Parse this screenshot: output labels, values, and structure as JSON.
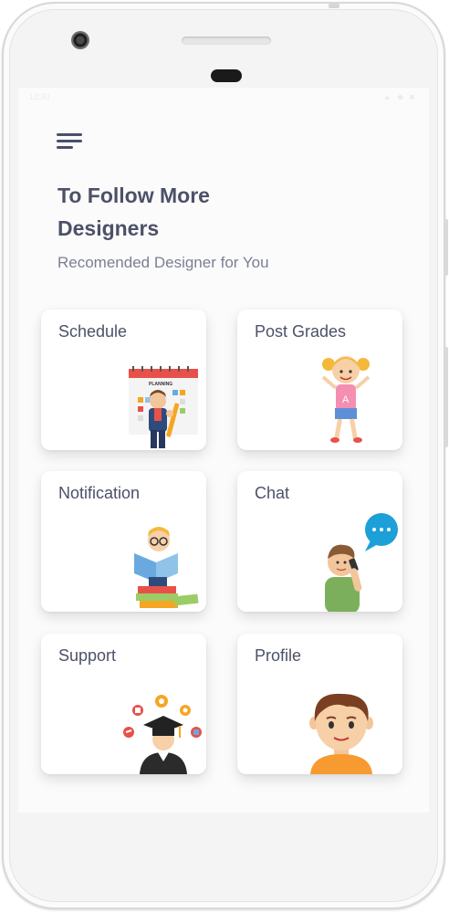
{
  "status": {
    "time": "12:30",
    "icons": "▲ ◆ ■"
  },
  "header": {
    "title": "To Follow More Designers",
    "subtitle": "Recomended Designer for You"
  },
  "cards": [
    {
      "label": "Schedule",
      "illustration": "planning-calendar-icon"
    },
    {
      "label": "Post Grades",
      "illustration": "happy-girl-icon"
    },
    {
      "label": "Notification",
      "illustration": "student-reading-books-icon"
    },
    {
      "label": "Chat",
      "illustration": "man-on-phone-chat-icon"
    },
    {
      "label": "Support",
      "illustration": "graduate-with-ideas-icon"
    },
    {
      "label": "Profile",
      "illustration": "boy-avatar-icon"
    }
  ],
  "calendar_label": "PLANNING",
  "colors": {
    "heading": "#4d5167",
    "subtitle": "#7b7f90",
    "card": "#ffffff",
    "chat_bubble": "#1d9fd8"
  }
}
